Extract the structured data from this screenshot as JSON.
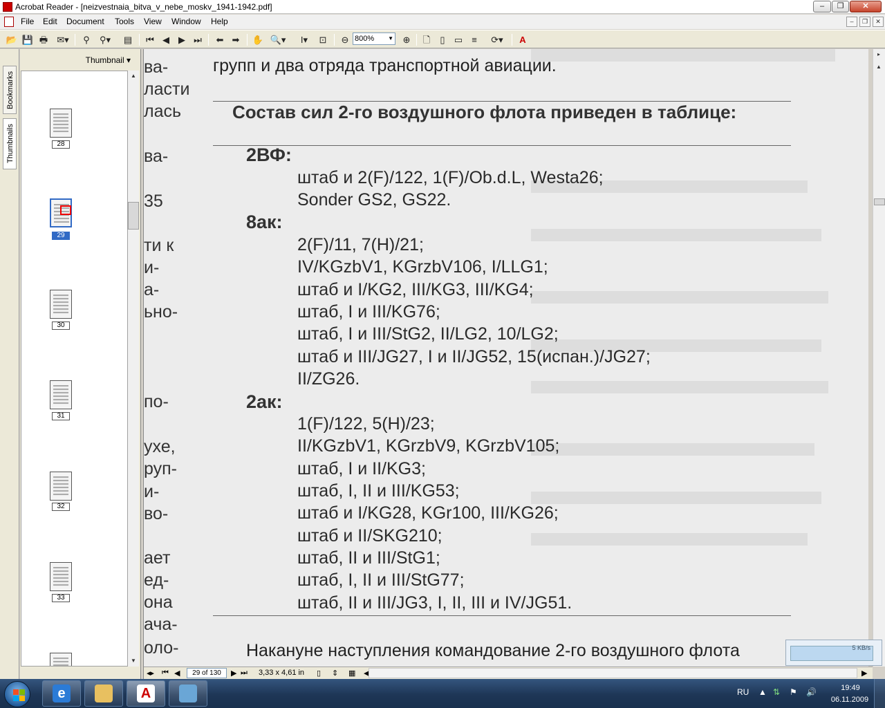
{
  "window": {
    "title": "Acrobat Reader - [neizvestnaia_bitva_v_nebe_moskv_1941-1942.pdf]",
    "controls": {
      "minimize": "–",
      "restore": "❐",
      "close": "✕"
    }
  },
  "menu": {
    "items": [
      "File",
      "Edit",
      "Document",
      "Tools",
      "View",
      "Window",
      "Help"
    ],
    "mdi_controls": {
      "minimize": "–",
      "restore": "❐",
      "close": "✕"
    }
  },
  "toolbar": {
    "zoom_value": "800%",
    "icons": [
      "open-icon",
      "save-icon",
      "print-icon",
      "email-icon",
      "search-icon",
      "find-icon",
      "show-hide-icon",
      "first-page-icon",
      "previous-page-icon",
      "next-page-icon",
      "last-page-icon",
      "previous-view-icon",
      "next-view-icon",
      "hand-tool-icon",
      "zoom-tool-icon",
      "select-text-icon",
      "snapshot-icon",
      "zoom-out-icon",
      "zoom-in-icon",
      "actual-size-icon",
      "fit-page-icon",
      "fit-width-icon",
      "reflow-icon",
      "rotate-icon",
      "adobe-logo-icon"
    ]
  },
  "nav_panel": {
    "tabs": [
      "Bookmarks",
      "Thumbnails"
    ],
    "header": "Thumbnail",
    "pages": [
      {
        "num": "28",
        "selected": false
      },
      {
        "num": "29",
        "selected": true
      },
      {
        "num": "30",
        "selected": false
      },
      {
        "num": "31",
        "selected": false
      },
      {
        "num": "32",
        "selected": false
      },
      {
        "num": "33",
        "selected": false
      }
    ]
  },
  "document": {
    "left_fragments": [
      "ва-",
      "ласти",
      "лась",
      "ва-",
      "35",
      "ти к",
      "и-",
      "а-",
      "ьно-",
      "по-",
      "ухе,",
      "руп-",
      "и-",
      "во-",
      "ает",
      "ед-",
      "она",
      "ача-",
      "оло-"
    ],
    "top_line": "групп и два отряда транспортной авиации.",
    "table_title": "Состав сил 2-го воздушного флота приведен в таблице:",
    "groups": [
      {
        "name": "2ВФ:",
        "units": [
          "штаб и 2(F)/122, 1(F)/Ob.d.L, Westa26;",
          "Sonder GS2, GS22."
        ]
      },
      {
        "name": "8ак:",
        "units": [
          "2(F)/11, 7(H)/21;",
          "IV/KGzbV1, KGrzbV106, I/LLG1;",
          "штаб и I/KG2, III/KG3, III/KG4;",
          "штаб, I и III/KG76;",
          "штаб, I и III/StG2, II/LG2, 10/LG2;",
          "штаб и III/JG27, I и II/JG52, 15(испан.)/JG27;",
          "II/ZG26."
        ]
      },
      {
        "name": "2ак:",
        "units": [
          "1(F)/122, 5(H)/23;",
          "II/KGzbV1, KGrzbV9, KGrzbV105;",
          "штаб, I и II/KG3;",
          "штаб, I, II и III/KG53;",
          "штаб и I/KG28, KGr100, III/KG26;",
          "штаб и II/SKG210;",
          "штаб, II и III/StG1;",
          "штаб, I, II и III/StG77;",
          "штаб, II и III/JG3, I, II, III и IV/JG51."
        ]
      }
    ],
    "bottom_line": "Накануне наступления командование 2-го воздушного флота"
  },
  "statusbar": {
    "page_counter": "29 of 130",
    "page_size": "3,33 x 4,61 in"
  },
  "net_widget": {
    "speed": "5 KB/s"
  },
  "taskbar": {
    "apps": [
      "ie-icon",
      "explorer-icon",
      "acrobat-icon",
      "virtualbox-icon"
    ],
    "lang": "RU",
    "time": "19:49",
    "date": "06.11.2009"
  }
}
